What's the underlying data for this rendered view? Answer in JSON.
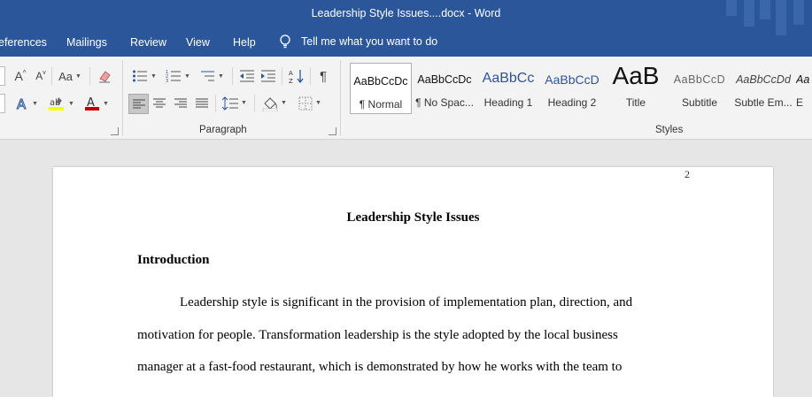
{
  "window": {
    "title": "Leadership Style Issues....docx  -  Word"
  },
  "tabs": [
    "eferences",
    "Mailings",
    "Review",
    "View",
    "Help"
  ],
  "tell_me": "Tell me what you want to do",
  "ribbon": {
    "font": {
      "case_label": "Aa",
      "grow_label": "A",
      "shrink_label": "A",
      "color_label": "A"
    },
    "paragraph_label": "Paragraph",
    "styles_label": "Styles",
    "styles": [
      {
        "preview": "AaBbCcDc",
        "name": "¶ Normal"
      },
      {
        "preview": "AaBbCcDc",
        "name": "¶ No Spac..."
      },
      {
        "preview": "AaBbCc",
        "name": "Heading 1"
      },
      {
        "preview": "AaBbCcD",
        "name": "Heading 2"
      },
      {
        "preview": "AaB",
        "name": "Title"
      },
      {
        "preview": "AaBbCcD",
        "name": "Subtitle"
      },
      {
        "preview": "AaBbCcDd",
        "name": "Subtle Em..."
      },
      {
        "preview": "Aa",
        "name": "E"
      }
    ],
    "colors": {
      "highlight": "#ffff00",
      "font_color": "#c00000",
      "accent": "#2b579a"
    }
  },
  "document": {
    "page_number": "2",
    "title": "Leadership Style Issues",
    "heading": "Introduction",
    "lines": [
      "Leadership style is significant in the provision of implementation plan, direction, and",
      "motivation for people. Transformation leadership is the style adopted by the local business",
      "manager at a fast-food restaurant, which is demonstrated by how he works with the team to"
    ]
  }
}
